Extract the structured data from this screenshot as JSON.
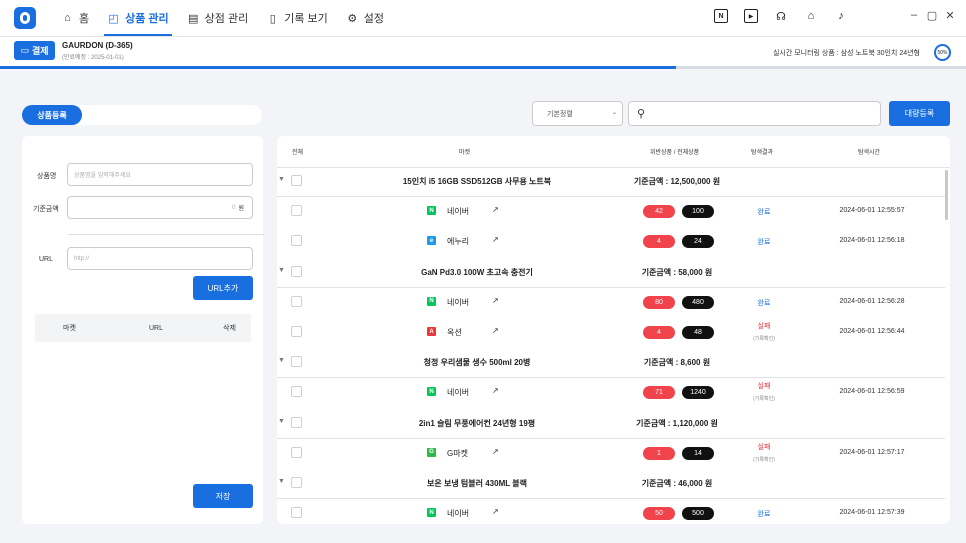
{
  "nav": {
    "items": [
      {
        "label": "홈",
        "icon": "home-icon"
      },
      {
        "label": "상품 관리",
        "icon": "shopping-bag-icon"
      },
      {
        "label": "상점 관리",
        "icon": "store-icon"
      },
      {
        "label": "기록 보기",
        "icon": "document-icon"
      },
      {
        "label": "설정",
        "icon": "gear-icon"
      }
    ],
    "active": "상품 관리",
    "right_icons": [
      "naver-icon",
      "play-icon",
      "headset-icon",
      "home-icon",
      "bell-icon"
    ],
    "window_controls": [
      "minimize-icon",
      "maximize-icon",
      "close-icon"
    ]
  },
  "subbar": {
    "pay_label": "결제",
    "account_name": "GAURDON (D-365)",
    "expiry": "(만료예정 : 2025-01-01)",
    "monitor_text": "실시간 모니터링 상품 : 삼성 노트북 30인치 24년형",
    "percent": "50%"
  },
  "progress_fraction": 0.7,
  "left": {
    "tab_label": "상품등록",
    "name_label": "상품명",
    "name_placeholder": "상품명을 입력해주세요",
    "price_label": "기준금액",
    "price_value": "0",
    "price_unit": "원",
    "url_label": "URL",
    "url_placeholder": "http://",
    "url_add": "URL추가",
    "table_headers": [
      "마켓",
      "URL",
      "삭제"
    ],
    "save": "저장"
  },
  "toolbar": {
    "sort_label": "기본정렬",
    "bulk_label": "대량등록"
  },
  "table": {
    "headers": {
      "all": "전체",
      "market": "마켓",
      "ratio": "위반상품 / 전체상품",
      "result": "탐색결과",
      "time": "탐색시간"
    },
    "groups": [
      {
        "title": "15인치 i5 16GB SSD512GB 사무용 노트북",
        "price": "기준금액 : 12,500,000 원",
        "rows": [
          {
            "market": "네이버",
            "icon": "N",
            "color": "#03c75a",
            "violate": "42",
            "total": "100",
            "result": "완료",
            "status": "ok",
            "time": "2024-06-01 12:55:57"
          },
          {
            "market": "에누리",
            "icon": "e",
            "color": "#1e9be9",
            "violate": "4",
            "total": "24",
            "result": "완료",
            "status": "ok",
            "time": "2024-06-01 12:56:18"
          }
        ]
      },
      {
        "title": "GaN Pd3.0 100W 초고속 충전기",
        "price": "기준금액 : 58,000 원",
        "rows": [
          {
            "market": "네이버",
            "icon": "N",
            "color": "#03c75a",
            "violate": "80",
            "total": "480",
            "result": "완료",
            "status": "ok",
            "time": "2024-06-01 12:56:28"
          },
          {
            "market": "옥션",
            "icon": "A",
            "color": "#e53935",
            "violate": "4",
            "total": "48",
            "result": "실패",
            "sub": "(기록확인)",
            "status": "fail",
            "time": "2024-06-01 12:56:44"
          }
        ]
      },
      {
        "title": "청정 우리샘물 생수 500ml 20병",
        "price": "기준금액 : 8,600 원",
        "rows": [
          {
            "market": "네이버",
            "icon": "N",
            "color": "#03c75a",
            "violate": "71",
            "total": "1240",
            "result": "실패",
            "sub": "(기록확인)",
            "status": "fail",
            "time": "2024-06-01 12:56:59"
          }
        ]
      },
      {
        "title": "2in1 슬림 무풍에어컨 24년형 19평",
        "price": "기준금액 : 1,120,000 원",
        "rows": [
          {
            "market": "G마켓",
            "icon": "G",
            "color": "#2fb94a",
            "violate": "1",
            "total": "14",
            "result": "실패",
            "sub": "(기록확인)",
            "status": "fail",
            "time": "2024-06-01 12:57:17"
          }
        ]
      },
      {
        "title": "보온 보냉 텀블러 430ML 블랙",
        "price": "기준금액 : 46,000 원",
        "rows": [
          {
            "market": "네이버",
            "icon": "N",
            "color": "#03c75a",
            "violate": "50",
            "total": "500",
            "result": "완료",
            "status": "ok",
            "time": "2024-06-01 12:57:39"
          }
        ]
      }
    ]
  }
}
